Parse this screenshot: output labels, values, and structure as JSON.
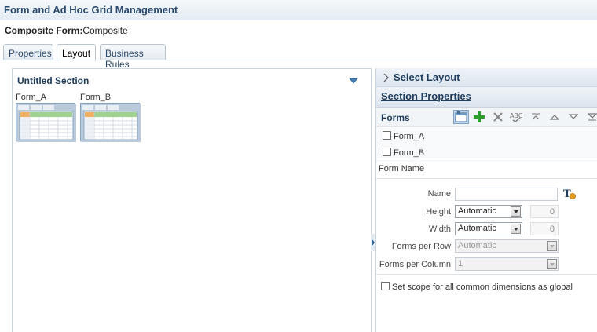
{
  "header": {
    "title": "Form and Ad Hoc Grid Management"
  },
  "composite": {
    "label": "Composite Form:",
    "value": "Composite"
  },
  "tabs": [
    {
      "label": "Properties"
    },
    {
      "label": "Layout"
    },
    {
      "label": "Business Rules"
    }
  ],
  "section": {
    "title": "Untitled Section",
    "forms": [
      {
        "label": "Form_A"
      },
      {
        "label": "Form_B"
      }
    ]
  },
  "right_panel": {
    "select_layout": "Select Layout",
    "section_properties": "Section Properties",
    "forms_label": "Forms",
    "form_list": [
      {
        "label": "Form_A"
      },
      {
        "label": "Form_B"
      }
    ],
    "form_name_header": "Form Name",
    "properties": {
      "name_label": "Name",
      "name_value": "",
      "height_label": "Height",
      "height_select": "Automatic",
      "height_value": "0",
      "width_label": "Width",
      "width_select": "Automatic",
      "width_value": "0",
      "forms_per_row_label": "Forms per Row",
      "forms_per_row_value": "Automatic",
      "forms_per_column_label": "Forms per Column",
      "forms_per_column_value": "1"
    },
    "scope_label": "Set scope for all common dimensions as global"
  },
  "colors": {
    "title_text": "#2b4a6a",
    "section_text": "#1f3d5c",
    "add_green": "#2e9d2e",
    "selected_tool": "#bcd3ea"
  },
  "icons": [
    "chevron-down-icon",
    "chevron-right-icon",
    "form-properties-icon",
    "add-icon",
    "delete-icon",
    "spellcheck-icon",
    "move-top-icon",
    "move-up-icon",
    "move-down-icon",
    "move-bottom-icon",
    "text-style-icon",
    "splitter-toggle-icon"
  ]
}
